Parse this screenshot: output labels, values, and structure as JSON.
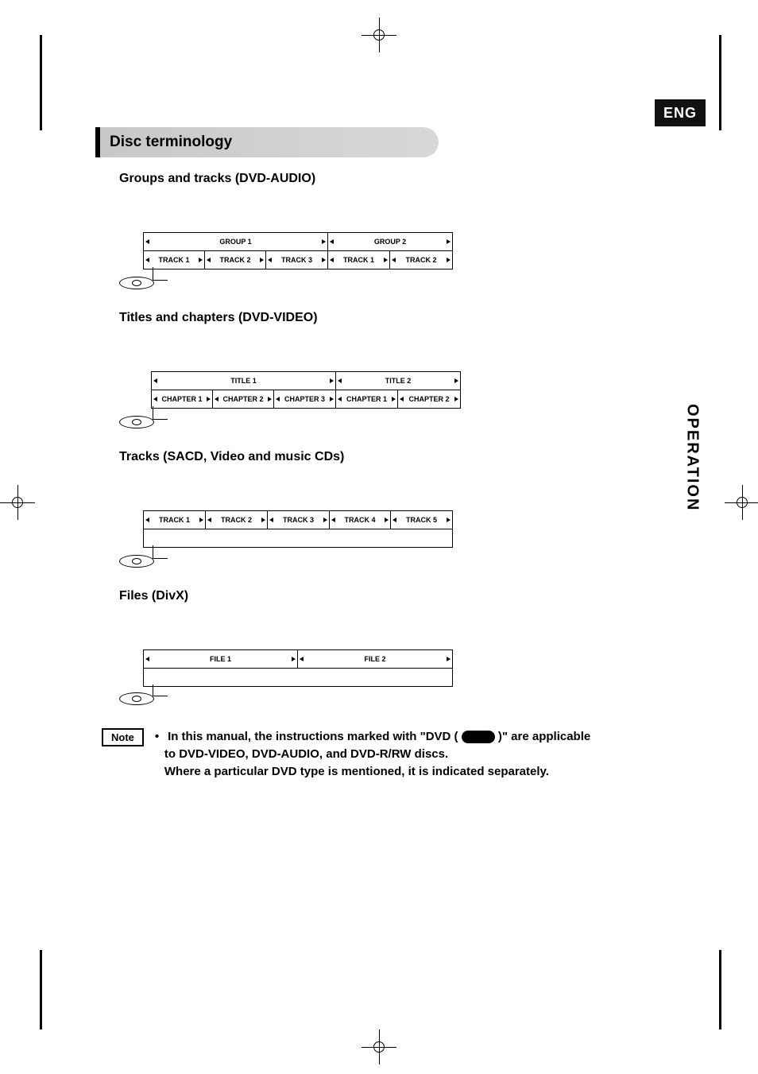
{
  "lang_tag": "ENG",
  "section_heading": "Disc terminology",
  "side_tab": "OPERATION",
  "subsections": {
    "groups": {
      "title": "Groups and tracks (DVD-AUDIO)",
      "top_row": [
        "GROUP 1",
        "GROUP 2"
      ],
      "bottom_row": [
        "TRACK 1",
        "TRACK 2",
        "TRACK 3",
        "TRACK 1",
        "TRACK 2"
      ],
      "group_spans": [
        3,
        2
      ]
    },
    "titles": {
      "title": "Titles and chapters (DVD-VIDEO)",
      "top_row": [
        "TITLE 1",
        "TITLE 2"
      ],
      "bottom_row": [
        "CHAPTER 1",
        "CHAPTER 2",
        "CHAPTER 3",
        "CHAPTER 1",
        "CHAPTER 2"
      ],
      "group_spans": [
        3,
        2
      ]
    },
    "tracks": {
      "title": "Tracks (SACD, Video and music CDs)",
      "row": [
        "TRACK 1",
        "TRACK 2",
        "TRACK 3",
        "TRACK 4",
        "TRACK 5"
      ]
    },
    "files": {
      "title": "Files (DivX)",
      "row": [
        "FILE 1",
        "FILE 2"
      ]
    }
  },
  "note": {
    "label": "Note",
    "line1a": "In this manual, the instructions marked with \"DVD (",
    "line1b": ")\" are applicable",
    "line2": "to DVD-VIDEO, DVD-AUDIO, and DVD-R/RW discs.",
    "line3": "Where a particular DVD type is mentioned, it is indicated separately."
  }
}
